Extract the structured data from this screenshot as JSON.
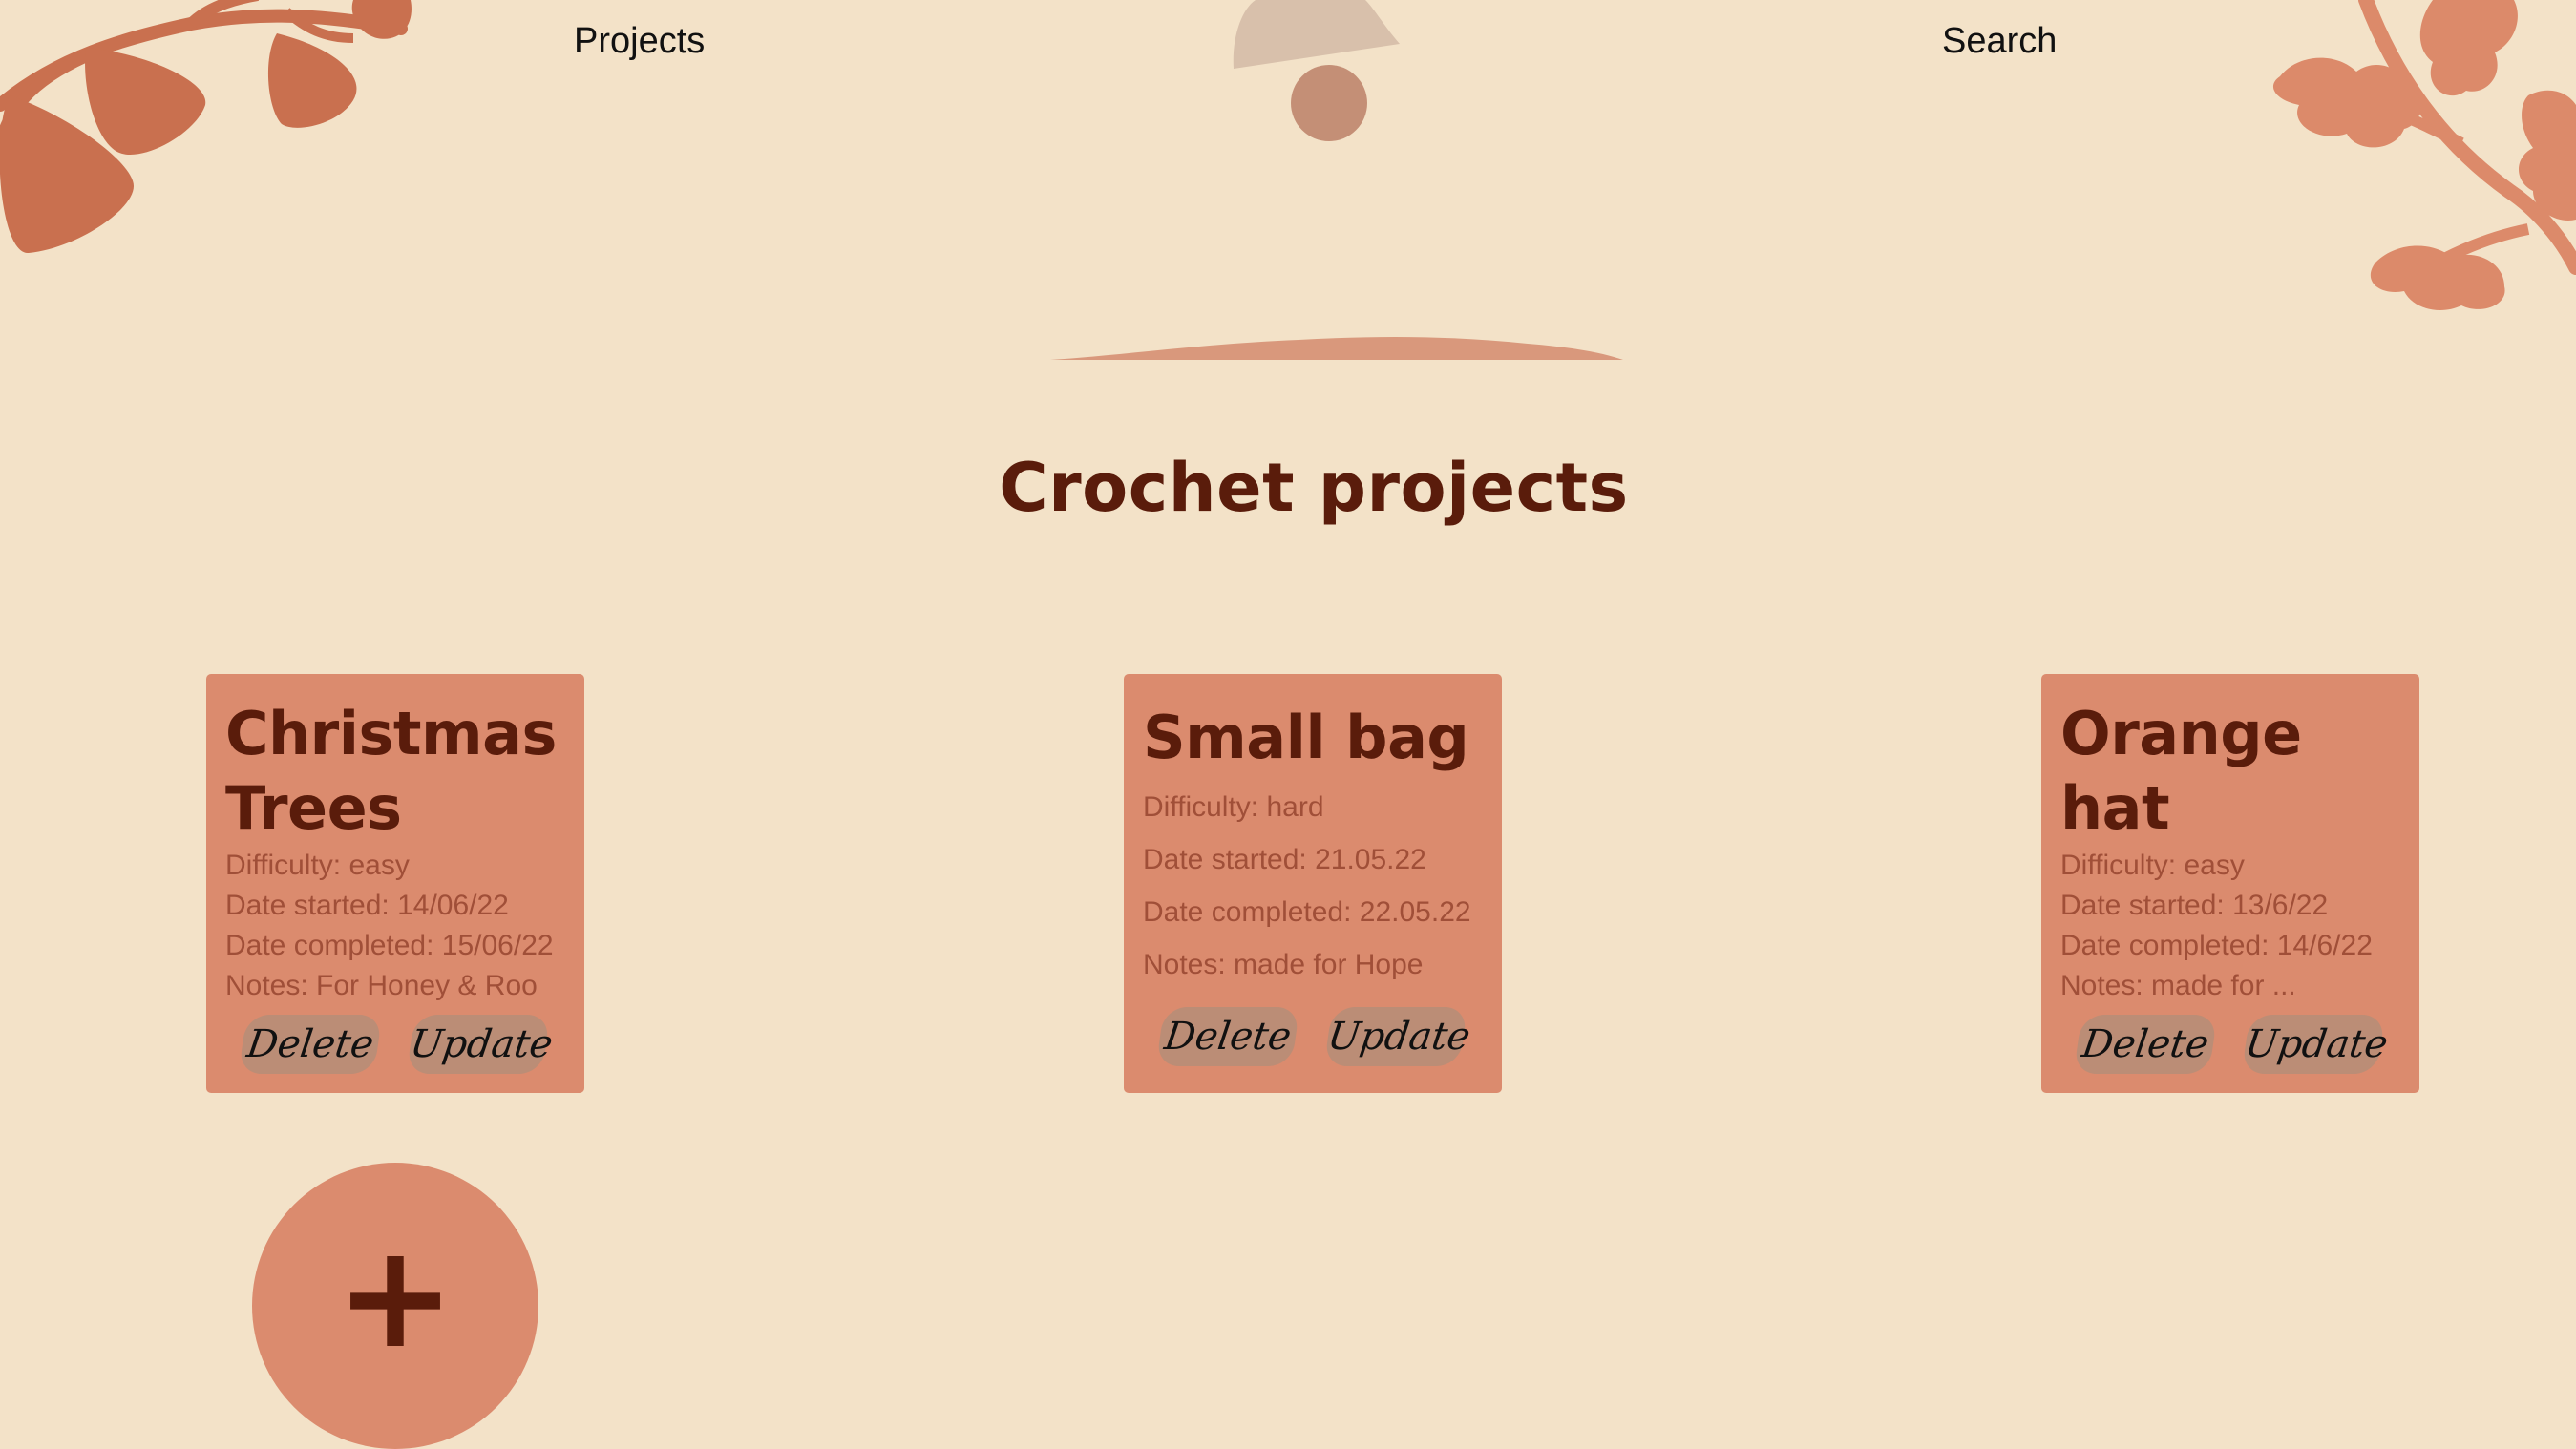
{
  "nav": {
    "projects_label": "Projects",
    "search_label": "Search"
  },
  "page_title": "Crochet projects",
  "cards": [
    {
      "title": "Christmas Trees",
      "difficulty": "Difficulty: easy",
      "date_started": "Date started: 14/06/22",
      "date_completed": "Date completed: 15/06/22",
      "notes": "Notes: For Honey & Roo",
      "delete_label": "Delete",
      "update_label": "Update"
    },
    {
      "title": "Small bag",
      "difficulty": "Difficulty: hard",
      "date_started": "Date started: 21.05.22",
      "date_completed": "Date completed: 22.05.22",
      "notes": "Notes: made for Hope",
      "delete_label": "Delete",
      "update_label": "Update"
    },
    {
      "title": "Orange hat",
      "difficulty": "Difficulty: easy",
      "date_started": "Date started: 13/6/22",
      "date_completed": "Date completed: 14/6/22",
      "notes": "Notes: made for ...",
      "delete_label": "Delete",
      "update_label": "Update"
    }
  ],
  "add_button": {
    "icon": "plus-icon",
    "symbol": "+"
  },
  "colors": {
    "background": "#f3e2c8",
    "card": "#db8b6e",
    "heading": "#5a1c0b",
    "detail_text": "#a04f38",
    "button": "#bb8d76"
  }
}
